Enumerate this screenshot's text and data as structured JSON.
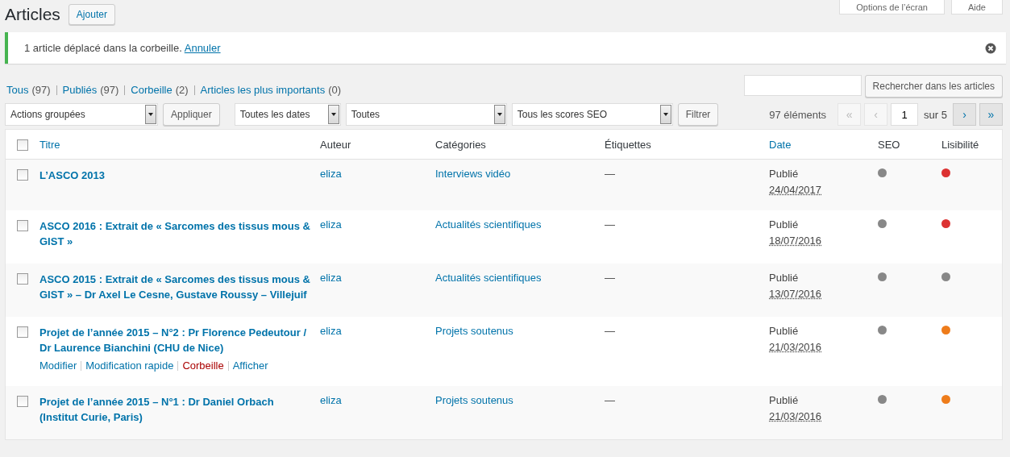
{
  "page_title": "Articles",
  "add_button": "Ajouter",
  "screen_meta": [
    "Options de l’écran",
    "Aide"
  ],
  "notice": {
    "text": "1 article déplacé dans la corbeille.",
    "link": "Annuler"
  },
  "views": [
    {
      "label": "Tous",
      "count": "(97)"
    },
    {
      "label": "Publiés",
      "count": "(97)"
    },
    {
      "label": "Corbeille",
      "count": "(2)"
    },
    {
      "label": "Articles les plus importants",
      "count": "(0)"
    }
  ],
  "search": {
    "button": "Rechercher dans les articles"
  },
  "filters": {
    "bulk": "Actions groupées",
    "apply": "Appliquer",
    "dates_label": "Toutes les dates",
    "categories": "Toutes",
    "seo": "Tous les scores SEO",
    "filter": "Filtrer"
  },
  "pagination": {
    "count": "97 éléments",
    "first": {
      "label": "«",
      "disabled": true
    },
    "prev": {
      "label": "‹",
      "disabled": true
    },
    "page": "1",
    "of": "sur 5",
    "next": {
      "label": "›",
      "disabled": false
    },
    "last": {
      "label": "»",
      "disabled": false
    }
  },
  "table": {
    "header_checked": false,
    "columns": [
      {
        "label": "Titre",
        "sortable": true
      },
      {
        "label": "Auteur",
        "sortable": false
      },
      {
        "label": "Catégories",
        "sortable": false
      },
      {
        "label": "Étiquettes",
        "sortable": false
      },
      {
        "label": "Date",
        "sortable": true
      },
      {
        "label": "SEO",
        "sortable": false
      },
      {
        "label": "Lisibilité",
        "sortable": false
      }
    ],
    "rows": [
      {
        "checked": false,
        "title": "L’ASCO 2013",
        "author": "eliza",
        "category": "Interviews vidéo",
        "tags": "—",
        "status": "Publié",
        "date": "24/04/2017",
        "seo": {
          "color": "#888888"
        },
        "readability": {
          "color": "#dc3232"
        }
      },
      {
        "checked": false,
        "title": "ASCO 2016 : Extrait de « Sarcomes des tissus mous & GIST »",
        "author": "eliza",
        "category": "Actualités scientifiques",
        "tags": "—",
        "status": "Publié",
        "date": "18/07/2016",
        "seo": {
          "color": "#888888"
        },
        "readability": {
          "color": "#dc3232"
        }
      },
      {
        "checked": false,
        "title": "ASCO 2015 : Extrait de « Sarcomes des tissus mous & GIST » – Dr Axel Le Cesne, Gustave Roussy – Villejuif",
        "author": "eliza",
        "category": "Actualités scientifiques",
        "tags": "—",
        "status": "Publié",
        "date": "13/07/2016",
        "seo": {
          "color": "#888888"
        },
        "readability": {
          "color": "#888888"
        }
      },
      {
        "checked": false,
        "title": "Projet de l’année 2015 – N°2 : Pr Florence Pedeutour / Dr Laurence Bianchini (CHU de Nice)",
        "author": "eliza",
        "category": "Projets soutenus",
        "tags": "—",
        "status": "Publié",
        "date": "21/03/2016",
        "seo": {
          "color": "#888888"
        },
        "readability": {
          "color": "#ee7c1b"
        },
        "actions": [
          {
            "label": "Modifier",
            "kind": "link"
          },
          {
            "label": "Modification rapide",
            "kind": "link"
          },
          {
            "label": "Corbeille",
            "kind": "delete"
          },
          {
            "label": "Afficher",
            "kind": "link"
          }
        ]
      },
      {
        "checked": false,
        "title": "Projet de l’année 2015 – N°1 : Dr Daniel Orbach (Institut Curie, Paris)",
        "author": "eliza",
        "category": "Projets soutenus",
        "tags": "—",
        "status": "Publié",
        "date": "21/03/2016",
        "seo": {
          "color": "#888888"
        },
        "readability": {
          "color": "#ee7c1b"
        }
      }
    ]
  }
}
